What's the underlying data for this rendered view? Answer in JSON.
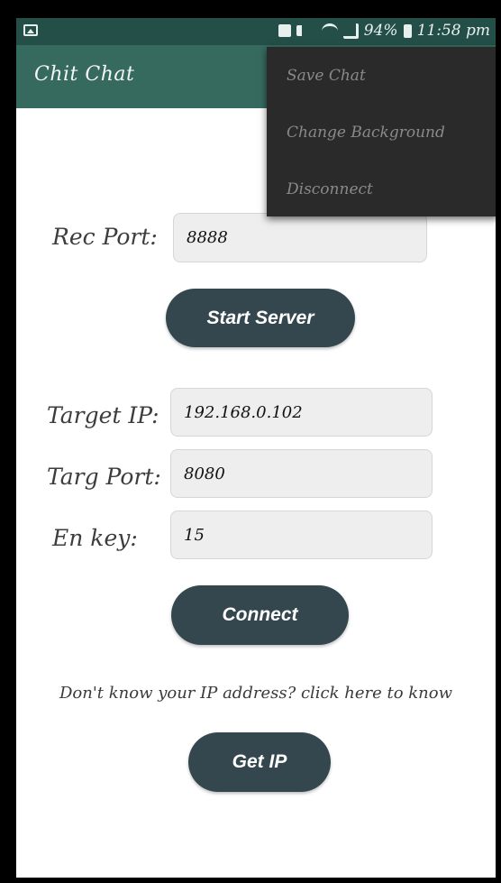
{
  "status_bar": {
    "battery": "94%",
    "time": "11:58 pm"
  },
  "app_bar": {
    "title": "Chit Chat"
  },
  "overflow_menu": {
    "items": [
      "Save Chat",
      "Change Background",
      "Disconnect"
    ]
  },
  "server": {
    "rec_port_label": "Rec Port:",
    "rec_port_value": "8888",
    "start_button": "Start Server"
  },
  "connection": {
    "target_ip_label": "Target IP:",
    "target_ip_value": "192.168.0.102",
    "targ_port_label": "Targ Port:",
    "targ_port_value": "8080",
    "en_key_label": "En key:",
    "en_key_value": "15",
    "connect_button": "Connect"
  },
  "ip_help": {
    "text": "Don't know your IP address? click here to know",
    "get_ip_button": "Get IP"
  },
  "colors": {
    "status_bar": "#244f49",
    "app_bar": "#376a5f",
    "button": "#34474f",
    "menu_bg": "#2a2a2a"
  }
}
